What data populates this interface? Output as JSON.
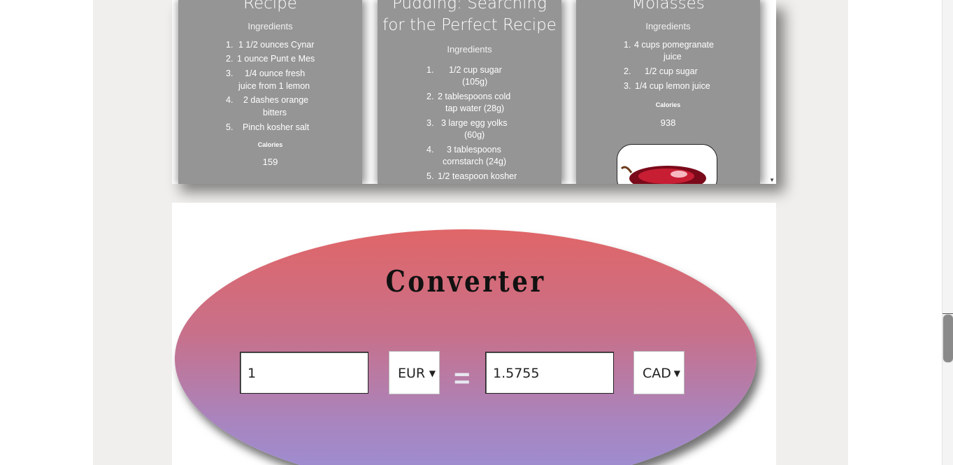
{
  "recipes": [
    {
      "title": "Recipe",
      "ingredients_label": "Ingredients",
      "ingredients": [
        {
          "num": "1.",
          "line1": "1 1/2 ounces Cynar",
          "line2": ""
        },
        {
          "num": "2.",
          "line1": "1 ounce Punt e Mes",
          "line2": ""
        },
        {
          "num": "3.",
          "line1": "1/4 ounce fresh",
          "line2": "juice from 1 lemon"
        },
        {
          "num": "4.",
          "line1": "2 dashes orange",
          "line2": "bitters"
        },
        {
          "num": "5.",
          "line1": "Pinch kosher salt",
          "line2": ""
        }
      ],
      "calories_label": "Calories",
      "calories": "159"
    },
    {
      "title_line1": "Pudding: Searching",
      "title_line2": "for the Perfect Recipe",
      "ingredients_label": "Ingredients",
      "ingredients": [
        {
          "num": "1.",
          "line1": "1/2 cup sugar",
          "line2": "(105g)"
        },
        {
          "num": "2.",
          "line1": "2 tablespoons cold",
          "line2": "tap water (28g)"
        },
        {
          "num": "3.",
          "line1": "3 large egg yolks",
          "line2": "(60g)"
        },
        {
          "num": "4.",
          "line1": "3 tablespoons",
          "line2": "cornstarch (24g)"
        },
        {
          "num": "5.",
          "line1": "1/2 teaspoon kosher",
          "line2": ""
        }
      ]
    },
    {
      "title": "Molasses",
      "ingredients_label": "Ingredients",
      "ingredients": [
        {
          "num": "1.",
          "line1": "4 cups pomegranate",
          "line2": "juice"
        },
        {
          "num": "2.",
          "line1": "1/2 cup sugar",
          "line2": ""
        },
        {
          "num": "3.",
          "line1": "1/4 cup lemon juice",
          "line2": ""
        }
      ],
      "calories_label": "Calories",
      "calories": "938"
    }
  ],
  "converter": {
    "title": "Converter",
    "from_value": "1",
    "from_currency": "EUR",
    "equals": "=",
    "to_value": "1.5755",
    "to_currency": "CAD"
  }
}
